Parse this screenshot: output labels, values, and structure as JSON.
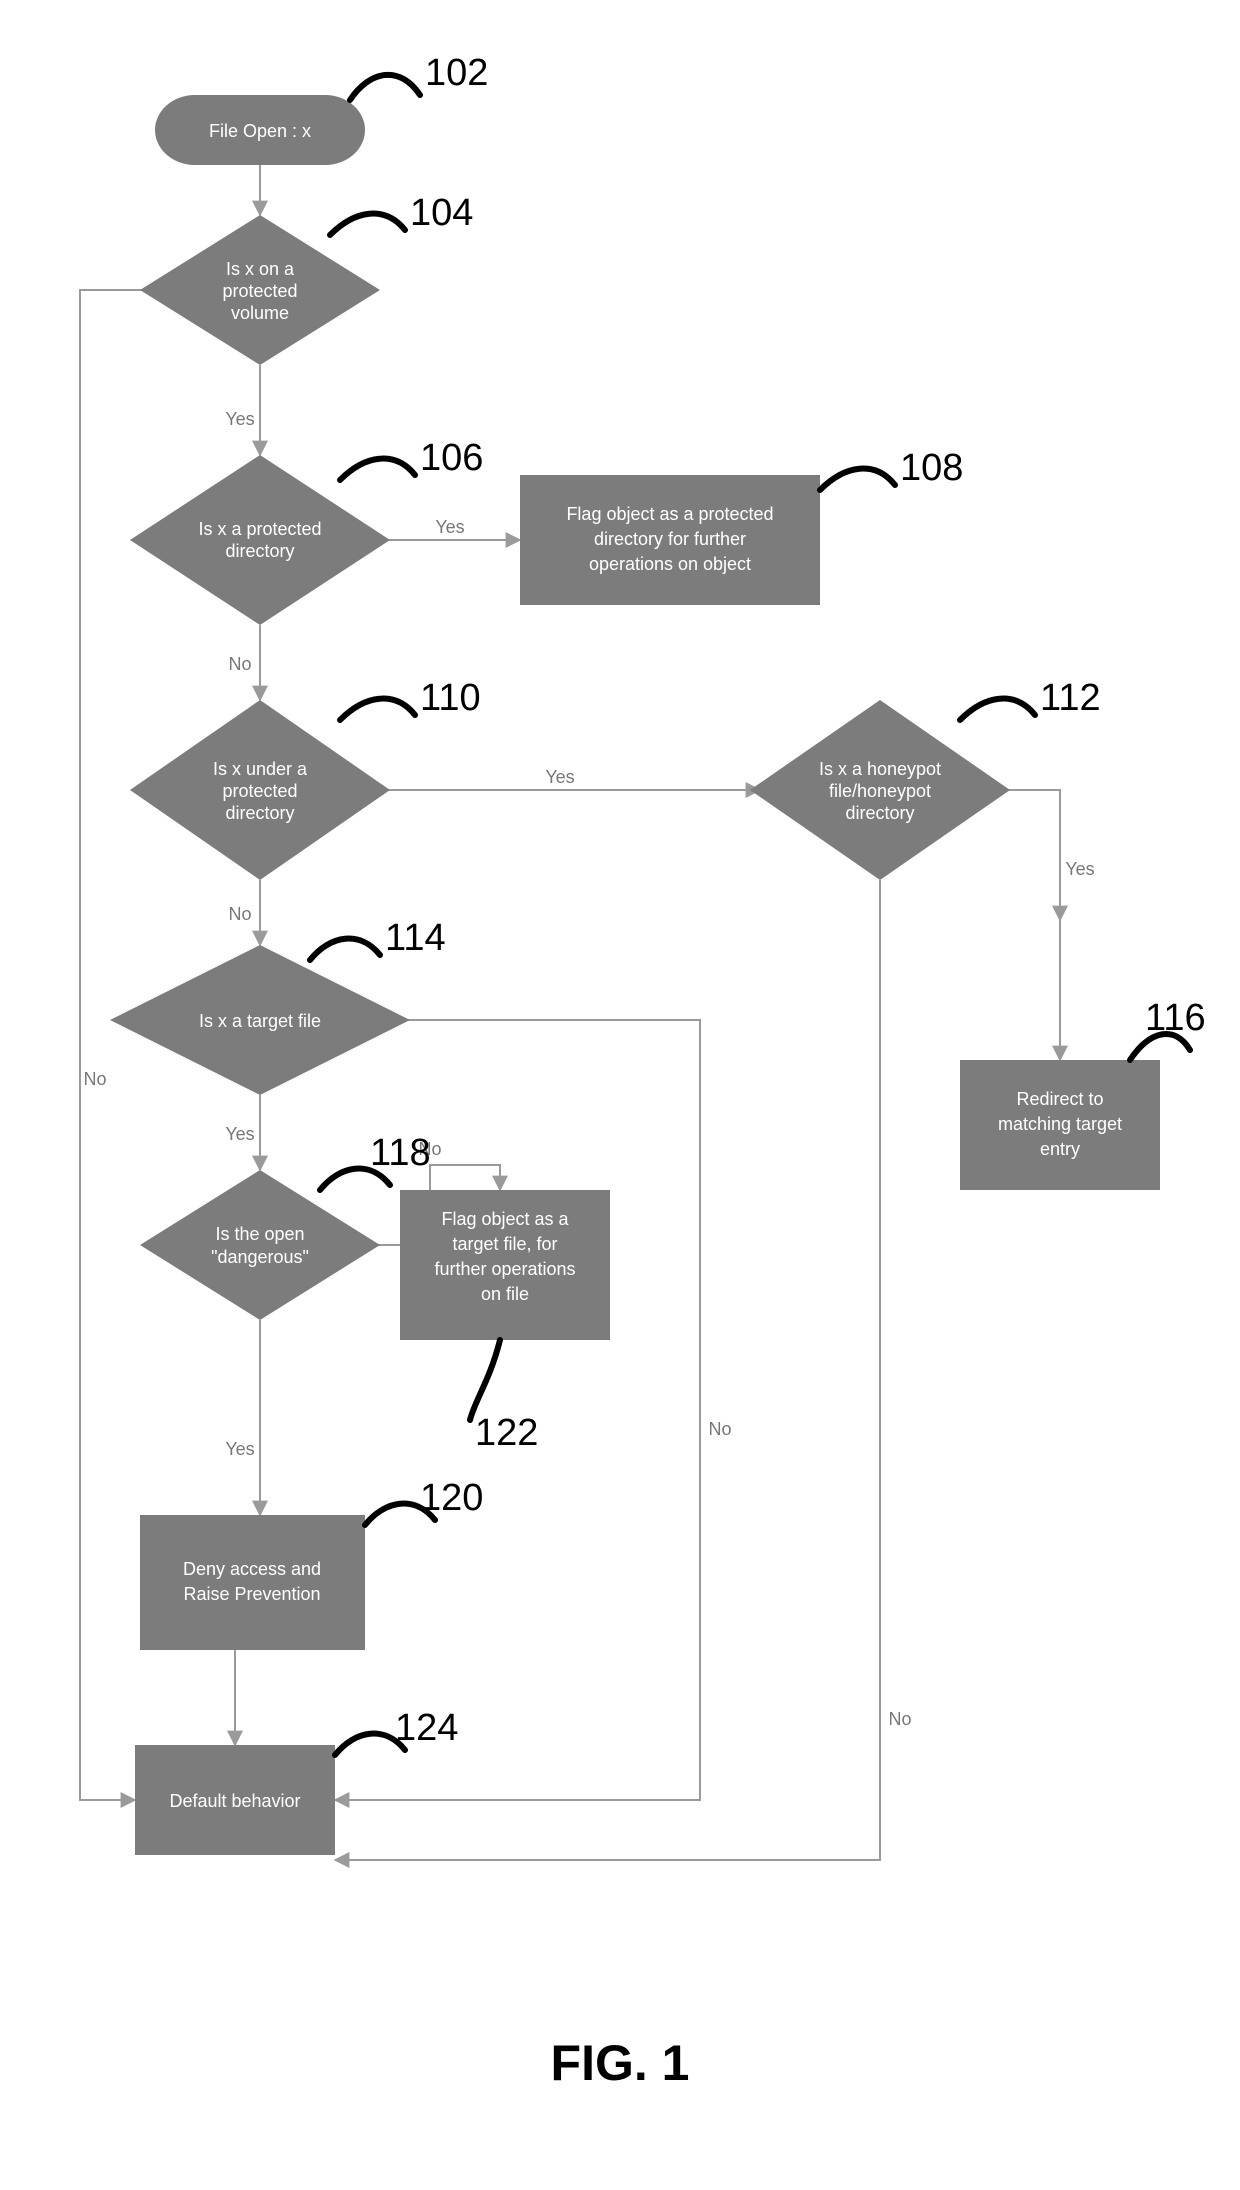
{
  "chart_data": {
    "type": "flowchart",
    "title": "FIG. 1",
    "nodes": [
      {
        "id": "102",
        "type": "terminator",
        "text": [
          "File Open : x"
        ],
        "ref": "102"
      },
      {
        "id": "104",
        "type": "decision",
        "text": [
          "Is x on a",
          "protected",
          "volume"
        ],
        "ref": "104"
      },
      {
        "id": "106",
        "type": "decision",
        "text": [
          "Is x a protected",
          "directory"
        ],
        "ref": "106"
      },
      {
        "id": "108",
        "type": "process",
        "text": [
          "Flag object as a protected",
          "directory for further",
          "operations on object"
        ],
        "ref": "108"
      },
      {
        "id": "110",
        "type": "decision",
        "text": [
          "Is x under a",
          "protected",
          "directory"
        ],
        "ref": "110"
      },
      {
        "id": "112",
        "type": "decision",
        "text": [
          "Is x a honeypot",
          "file/honeypot",
          "directory"
        ],
        "ref": "112"
      },
      {
        "id": "114",
        "type": "decision",
        "text": [
          "Is x a target file"
        ],
        "ref": "114"
      },
      {
        "id": "116",
        "type": "process",
        "text": [
          "Redirect to",
          "matching target",
          "entry"
        ],
        "ref": "116"
      },
      {
        "id": "118",
        "type": "decision",
        "text": [
          "Is the open",
          "\"dangerous\""
        ],
        "ref": "118"
      },
      {
        "id": "120",
        "type": "process",
        "text": [
          "Deny access and",
          "Raise Prevention"
        ],
        "ref": "120"
      },
      {
        "id": "122",
        "type": "process",
        "text": [
          "Flag object as a",
          "target file, for",
          "further operations",
          "on file"
        ],
        "ref": "122"
      },
      {
        "id": "124",
        "type": "process",
        "text": [
          "Default behavior"
        ],
        "ref": "124"
      }
    ],
    "edges": [
      {
        "from": "102",
        "to": "104",
        "label": ""
      },
      {
        "from": "104",
        "to": "106",
        "label": "Yes"
      },
      {
        "from": "104",
        "to": "124",
        "label": "No"
      },
      {
        "from": "106",
        "to": "108",
        "label": "Yes"
      },
      {
        "from": "106",
        "to": "110",
        "label": "No"
      },
      {
        "from": "110",
        "to": "112",
        "label": "Yes"
      },
      {
        "from": "110",
        "to": "114",
        "label": "No"
      },
      {
        "from": "112",
        "to": "116",
        "label": "Yes"
      },
      {
        "from": "112",
        "to": "124",
        "label": "No"
      },
      {
        "from": "114",
        "to": "118",
        "label": "Yes"
      },
      {
        "from": "114",
        "to": "124",
        "label": "No"
      },
      {
        "from": "118",
        "to": "122",
        "label": "No"
      },
      {
        "from": "118",
        "to": "120",
        "label": "Yes"
      },
      {
        "from": "120",
        "to": "124",
        "label": ""
      }
    ],
    "figure_label": "FIG. 1"
  }
}
